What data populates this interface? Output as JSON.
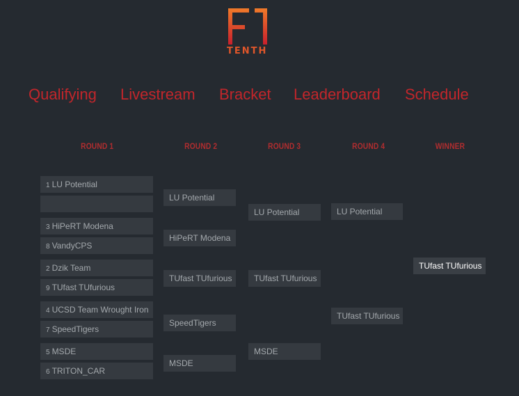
{
  "logo": {
    "tenth_text": "TENTH"
  },
  "nav": {
    "qualifying": "Qualifying",
    "livestream": "Livestream",
    "bracket": "Bracket",
    "leaderboard": "Leaderboard",
    "schedule": "Schedule"
  },
  "rounds": {
    "r1": "ROUND 1",
    "r2": "ROUND 2",
    "r3": "ROUND 3",
    "r4": "ROUND 4",
    "winner": "WINNER"
  },
  "round1": [
    {
      "seed": "1",
      "name": "LU Potential"
    },
    {
      "seed": "",
      "name": ""
    },
    {
      "seed": "3",
      "name": "HiPeRT Modena"
    },
    {
      "seed": "8",
      "name": "VandyCPS"
    },
    {
      "seed": "2",
      "name": "Dzik Team"
    },
    {
      "seed": "9",
      "name": "TUfast TUfurious"
    },
    {
      "seed": "4",
      "name": "UCSD Team Wrought Iron"
    },
    {
      "seed": "7",
      "name": "SpeedTigers"
    },
    {
      "seed": "5",
      "name": "MSDE"
    },
    {
      "seed": "6",
      "name": "TRITON_CAR"
    }
  ],
  "round2": [
    "LU Potential",
    "HiPeRT Modena",
    "TUfast TUfurious",
    "SpeedTigers",
    "MSDE"
  ],
  "round3": [
    "LU Potential",
    "TUfast TUfurious",
    "MSDE"
  ],
  "round4": [
    "LU Potential",
    "TUfast TUfurious"
  ],
  "winner": "TUfast TUfurious",
  "colors": {
    "background": "#252a30",
    "accent": "#c2262b",
    "team_box": "#353a40",
    "team_text": "#a4a9ad"
  }
}
